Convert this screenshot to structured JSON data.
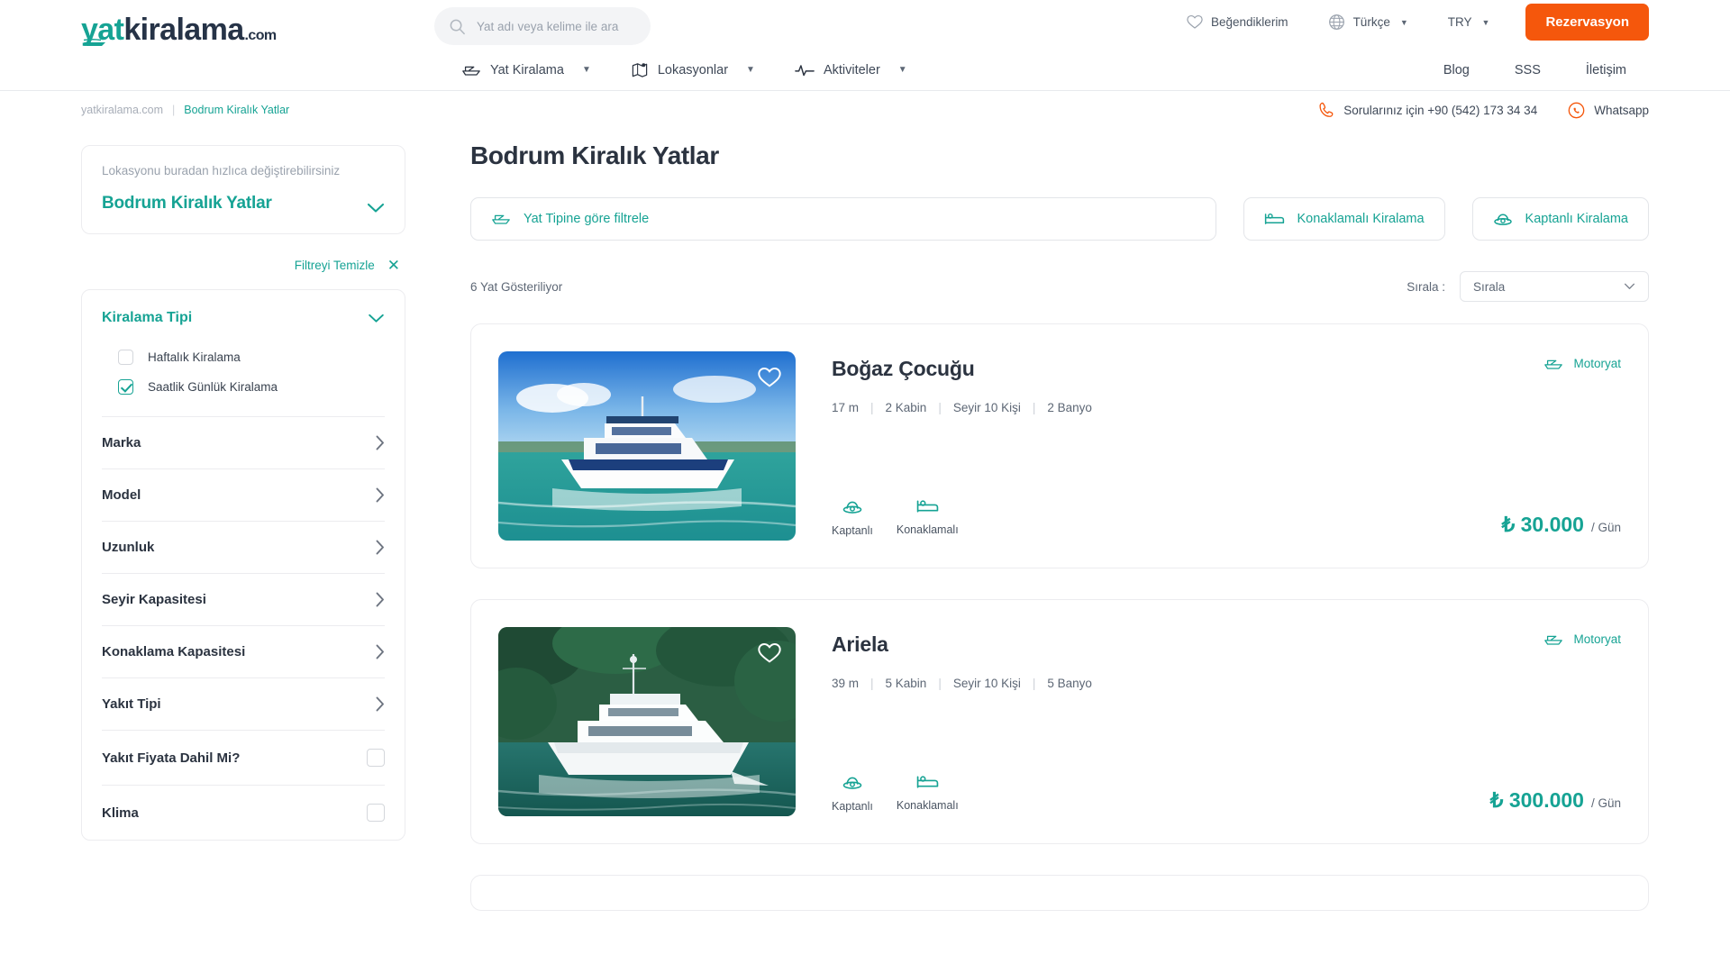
{
  "brand": {
    "logo_part1": "yat",
    "logo_part2": "kiralama",
    "logo_part3": ".com",
    "accent_teal": "#16a394",
    "accent_orange": "#f5570c",
    "navy": "#263347"
  },
  "header": {
    "search": {
      "placeholder": "Yat adı veya kelime ile ara",
      "value": "",
      "icon": "search-icon"
    },
    "favorites_label": "Beğendiklerim",
    "language_label": "Türkçe",
    "currency_label": "TRY",
    "reserve_label": "Rezervasyon"
  },
  "nav": {
    "items": [
      {
        "label": "Yat Kiralama",
        "icon": "boat-icon",
        "has_chevron": true
      },
      {
        "label": "Lokasyonlar",
        "icon": "map-icon",
        "has_chevron": true
      },
      {
        "label": "Aktiviteler",
        "icon": "activity-icon",
        "has_chevron": true
      }
    ],
    "links": [
      {
        "label": "Blog"
      },
      {
        "label": "SSS"
      },
      {
        "label": "İletişim"
      }
    ]
  },
  "breadcrumb": {
    "root": "yatkiralama.com",
    "separator": "|",
    "current": "Bodrum Kiralık Yatlar"
  },
  "contact": {
    "phone_label": "Sorularınız için +90 (542) 173 34 34",
    "whatsapp_label": "Whatsapp"
  },
  "sidebar": {
    "location_hint": "Lokasyonu buradan hızlıca değiştirebilirsiniz",
    "location_value": "Bodrum Kiralık Yatlar",
    "clear_filter_label": "Filtreyi Temizle",
    "rental_type": {
      "title": "Kiralama Tipi",
      "options": [
        {
          "label": "Haftalık Kiralama",
          "checked": false
        },
        {
          "label": "Saatlik Günlük Kiralama",
          "checked": true
        }
      ]
    },
    "filters": [
      {
        "label": "Marka",
        "control": "chevron"
      },
      {
        "label": "Model",
        "control": "chevron"
      },
      {
        "label": "Uzunluk",
        "control": "chevron"
      },
      {
        "label": "Seyir Kapasitesi",
        "control": "chevron"
      },
      {
        "label": "Konaklama Kapasitesi",
        "control": "chevron"
      },
      {
        "label": "Yakıt Tipi",
        "control": "chevron"
      },
      {
        "label": "Yakıt Fiyata Dahil Mi?",
        "control": "checkbox"
      },
      {
        "label": "Klima",
        "control": "checkbox"
      }
    ]
  },
  "main": {
    "title": "Bodrum Kiralık Yatlar",
    "filter_buttons": [
      {
        "label": "Yat Tipine göre filtrele",
        "icon": "boat-icon"
      },
      {
        "label": "Konaklamalı Kiralama",
        "icon": "bed-icon"
      },
      {
        "label": "Kaptanlı Kiralama",
        "icon": "captain-icon"
      }
    ],
    "result_count": "6 Yat Gösteriliyor",
    "sort_label": "Sırala :",
    "sort_value": "Sırala",
    "yachts": [
      {
        "name": "Boğaz Çocuğu",
        "length": "17 m",
        "cabins": "2 Kabin",
        "cruise": "Seyir 10 Kişi",
        "baths": "2 Banyo",
        "type_label": "Motoryat",
        "options": [
          {
            "label": "Kaptanlı",
            "icon": "captain-icon"
          },
          {
            "label": "Konaklamalı",
            "icon": "bed-icon"
          }
        ],
        "price": "₺ 30.000",
        "period": "/ Gün",
        "photo_scene": "blue-motoryacht-on-turquoise-sea"
      },
      {
        "name": "Ariela",
        "length": "39 m",
        "cabins": "5 Kabin",
        "cruise": "Seyir 10 Kişi",
        "baths": "5 Banyo",
        "type_label": "Motoryat",
        "options": [
          {
            "label": "Kaptanlı",
            "icon": "captain-icon"
          },
          {
            "label": "Konaklamalı",
            "icon": "bed-icon"
          }
        ],
        "price": "₺ 300.000",
        "period": "/ Gün",
        "photo_scene": "white-megayacht-near-green-coast"
      }
    ]
  }
}
